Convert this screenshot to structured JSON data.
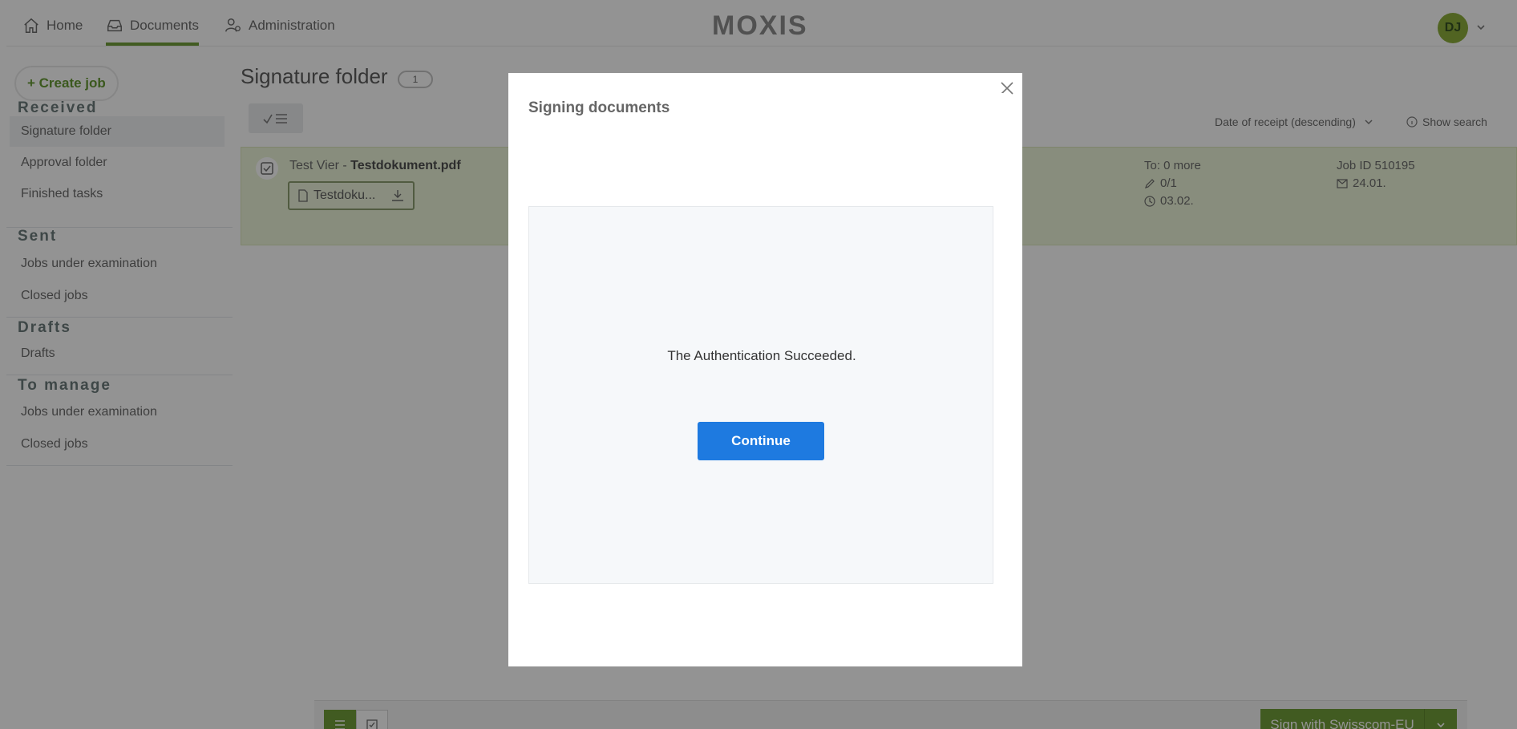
{
  "nav": {
    "home": "Home",
    "documents": "Documents",
    "administration": "Administration",
    "logo": "MOXIS",
    "avatar_initials": "DJ"
  },
  "sidebar": {
    "create_job": "+ Create job",
    "sections": [
      {
        "title": "Received",
        "items": [
          "Signature folder",
          "Approval folder",
          "Finished tasks"
        ]
      },
      {
        "title": "Sent",
        "items": [
          "Jobs under examination",
          "Closed jobs"
        ]
      },
      {
        "title": "Drafts",
        "items": [
          "Drafts"
        ]
      },
      {
        "title": "To manage",
        "items": [
          "Jobs under examination",
          "Closed jobs"
        ]
      }
    ]
  },
  "main": {
    "title": "Signature folder",
    "count": "1",
    "sort_label": "Date of receipt (descending)",
    "show_search": "Show search",
    "row": {
      "sender": "Test Vier",
      "separator": " - ",
      "document": "Testdokument.pdf",
      "attachment": "Testdoku...",
      "to": "To: 0 more",
      "progress": "0/1",
      "due": "03.02.",
      "job_id": "Job ID 510195",
      "received": "24.01."
    },
    "sign_button": "Sign with Swisscom-EU"
  },
  "modal": {
    "heading": "Signing documents",
    "message": "The Authentication Succeeded.",
    "continue": "Continue"
  },
  "colors": {
    "accent_green": "#5b8f1b",
    "primary_blue": "#1e7ae0",
    "row_highlight": "#e8f2d2"
  }
}
